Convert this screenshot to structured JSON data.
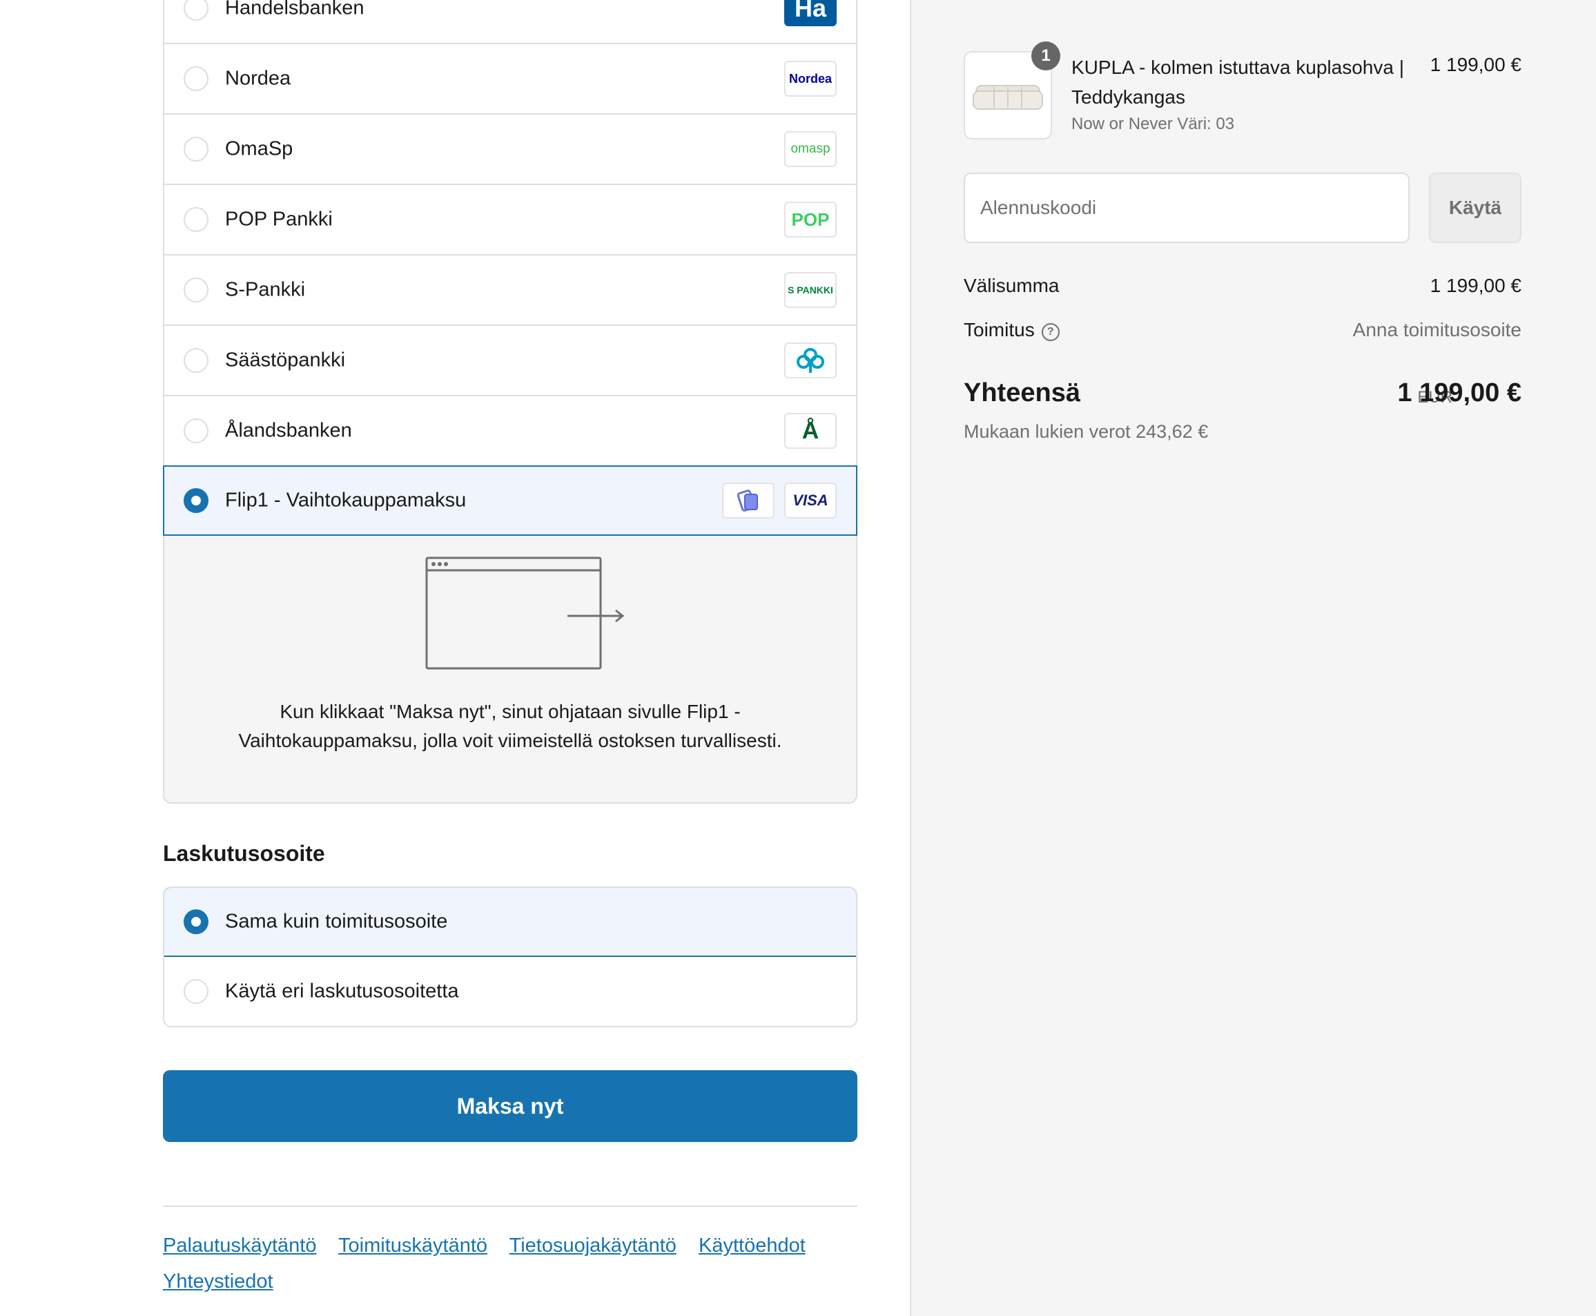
{
  "payment": {
    "banks": [
      {
        "label": "Handelsbanken",
        "logo": "Ha",
        "logo_color": "#005a9c"
      },
      {
        "label": "Nordea",
        "logo": "Nordea",
        "logo_color": "#0000a0"
      },
      {
        "label": "OmaSp",
        "logo": "omasp",
        "logo_color": "#3ab54a"
      },
      {
        "label": "POP Pankki",
        "logo": "POP",
        "logo_color": "#3ccf63"
      },
      {
        "label": "S-Pankki",
        "logo": "S PANKKI",
        "logo_color": "#00843d"
      },
      {
        "label": "Säästöpankki",
        "logo": "clover-icon",
        "logo_color": "#00a0c6"
      },
      {
        "label": "Ålandsbanken",
        "logo": "Å",
        "logo_color": "#0a5f2c"
      }
    ],
    "selected_method": {
      "label": "Flip1 - Vaihtokauppamaksu",
      "logo_visa": "VISA",
      "logo_flip": "flip1-icon"
    },
    "redirect_text": "Kun klikkaat \"Maksa nyt\", sinut ohjataan sivulle Flip1 - Vaihtokauppamaksu, jolla voit viimeistellä ostoksen turvallisesti."
  },
  "billing": {
    "title": "Laskutusosoite",
    "options": [
      {
        "label": "Sama kuin toimitusosoite",
        "selected": true
      },
      {
        "label": "Käytä eri laskutusosoitetta",
        "selected": false
      }
    ]
  },
  "pay_button": "Maksa nyt",
  "footer": {
    "links": [
      "Palautuskäytäntö",
      "Toimituskäytäntö",
      "Tietosuojakäytäntö",
      "Käyttöehdot",
      "Yhteystiedot"
    ]
  },
  "order": {
    "quantity": "1",
    "product_name": "KUPLA - kolmen istuttava kuplasohva | Teddykangas",
    "variant": "Now or Never Väri: 03",
    "price": "1 199,00 €",
    "discount_placeholder": "Alennuskoodi",
    "apply_label": "Käytä",
    "subtotal_label": "Välisumma",
    "subtotal_value": "1 199,00 €",
    "shipping_label": "Toimitus",
    "shipping_value": "Anna toimitusosoite",
    "total_label": "Yhteensä",
    "currency": "EUR",
    "total_value": "1 199,00 €",
    "tax_note": "Mukaan lukien verot 243,62 €"
  },
  "colors": {
    "accent": "#1773b0",
    "selected_bg": "#f0f5fd",
    "sidebar_bg": "#f5f5f5"
  }
}
